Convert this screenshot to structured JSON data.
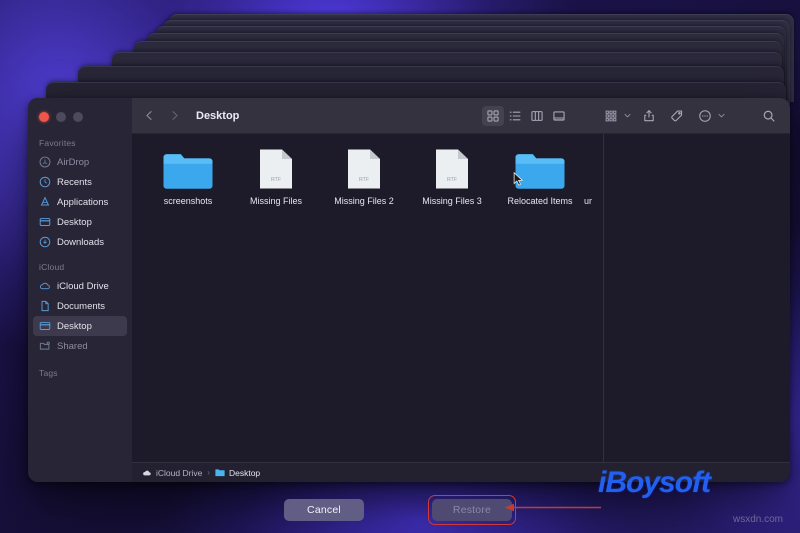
{
  "window": {
    "title": "Desktop",
    "traffic_lights": [
      "close",
      "minimize",
      "maximize"
    ]
  },
  "sidebar": {
    "sections": [
      {
        "header": "Favorites",
        "items": [
          {
            "label": "AirDrop",
            "icon": "airdrop-icon",
            "state": "dim"
          },
          {
            "label": "Recents",
            "icon": "clock-icon",
            "state": "normal"
          },
          {
            "label": "Applications",
            "icon": "applications-icon",
            "state": "normal"
          },
          {
            "label": "Desktop",
            "icon": "desktop-icon",
            "state": "normal"
          },
          {
            "label": "Downloads",
            "icon": "downloads-icon",
            "state": "normal"
          }
        ]
      },
      {
        "header": "iCloud",
        "items": [
          {
            "label": "iCloud Drive",
            "icon": "cloud-icon",
            "state": "normal"
          },
          {
            "label": "Documents",
            "icon": "document-icon",
            "state": "normal"
          },
          {
            "label": "Desktop",
            "icon": "desktop-icon",
            "state": "selected"
          },
          {
            "label": "Shared",
            "icon": "shared-folder-icon",
            "state": "dim"
          }
        ]
      },
      {
        "header": "Tags",
        "items": []
      }
    ]
  },
  "toolbar": {
    "back_label": "Back",
    "forward_label": "Forward",
    "view_buttons": [
      {
        "name": "icon-view-icon",
        "active": true
      },
      {
        "name": "list-view-icon",
        "active": false
      },
      {
        "name": "column-view-icon",
        "active": false
      },
      {
        "name": "gallery-view-icon",
        "active": false
      }
    ],
    "action_buttons": [
      {
        "name": "group-by-icon",
        "chevron": true
      },
      {
        "name": "share-icon",
        "chevron": false
      },
      {
        "name": "tag-icon",
        "chevron": false
      },
      {
        "name": "more-options-icon",
        "chevron": true
      }
    ],
    "search_icon": "search-icon"
  },
  "files": [
    {
      "name": "screenshots",
      "type": "folder",
      "badge": ""
    },
    {
      "name": "Missing Files",
      "type": "rtf-document",
      "badge": "RTF"
    },
    {
      "name": "Missing Files 2",
      "type": "rtf-document",
      "badge": "RTF"
    },
    {
      "name": "Missing Files 3",
      "type": "rtf-document",
      "badge": "RTF"
    },
    {
      "name": "Relocated Items",
      "type": "folder",
      "badge": ""
    },
    {
      "name": "ur",
      "type": "truncated",
      "badge": ""
    }
  ],
  "pathbar": {
    "items": [
      {
        "label": "iCloud Drive",
        "icon": "cloud-icon"
      },
      {
        "label": "Desktop",
        "icon": "folder-icon"
      }
    ],
    "separator": "›"
  },
  "actions": {
    "cancel_label": "Cancel",
    "restore_label": "Restore",
    "restore_disabled": true,
    "highlight_color": "#cf3a34"
  },
  "watermark": {
    "brand": "iBoysoft",
    "url": "wsxdn.com"
  }
}
